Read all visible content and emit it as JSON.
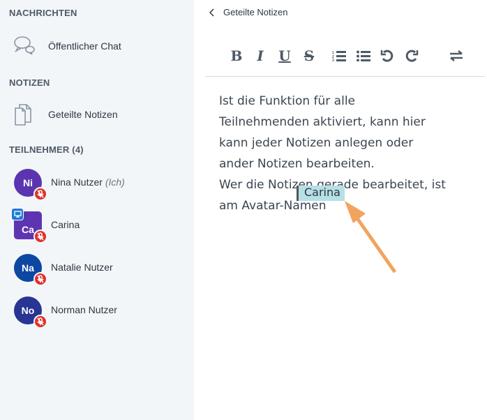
{
  "sidebar": {
    "messages_heading": "NACHRICHTEN",
    "public_chat": "Öffentlicher Chat",
    "notes_heading": "NOTIZEN",
    "shared_notes": "Geteilte Notizen",
    "participants_heading": "TEILNEHMER (4)",
    "users": [
      {
        "initials": "Ni",
        "name": "Nina Nutzer",
        "suffix": "(Ich)",
        "color": "#5b35b0",
        "shape": "circle",
        "muted": true,
        "presenter": false
      },
      {
        "initials": "Ca",
        "name": "Carina",
        "suffix": "",
        "color": "#5e35b1",
        "shape": "square",
        "muted": true,
        "presenter": true
      },
      {
        "initials": "Na",
        "name": "Natalie Nutzer",
        "suffix": "",
        "color": "#0d47a1",
        "shape": "circle",
        "muted": true,
        "presenter": false
      },
      {
        "initials": "No",
        "name": "Norman Nutzer",
        "suffix": "",
        "color": "#283593",
        "shape": "circle",
        "muted": true,
        "presenter": false
      }
    ]
  },
  "panel": {
    "title": "Geteilte Notizen",
    "toolbar": [
      "bold",
      "italic",
      "underline",
      "strikethrough",
      "ordered-list",
      "bullet-list",
      "undo",
      "redo",
      "swap"
    ],
    "text_lines": [
      "Ist die Funktion für alle",
      "Teilnehmenden aktiviert, kann hier",
      "kann jeder Notizen anlegen oder",
      "ander Notizen bearbeiten.",
      "Wer die Notizen gerade bearbeitet, ist",
      "am Avatar-Namen"
    ],
    "cursor_label": "Carina",
    "annotation_arrow_color": "#f2a35e"
  }
}
